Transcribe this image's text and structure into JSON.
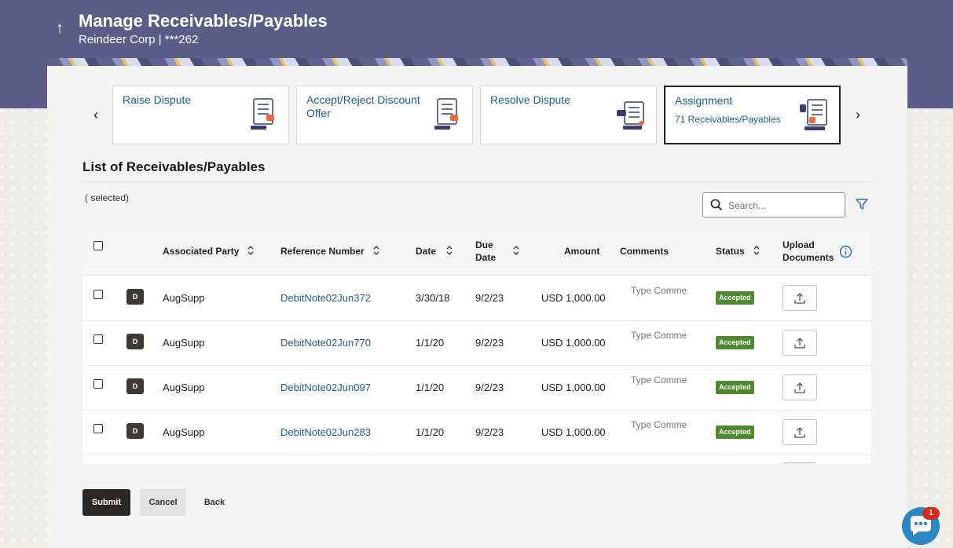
{
  "header": {
    "title": "Manage Receivables/Payables",
    "subtitle": "Reindeer Corp | ***262",
    "back_icon": "↑"
  },
  "carousel": {
    "prev_icon": "‹",
    "next_icon": "›",
    "cards": [
      {
        "title": "Raise Dispute",
        "sub": ""
      },
      {
        "title": "Accept/Reject Discount Offer",
        "sub": ""
      },
      {
        "title": "Resolve Dispute",
        "sub": ""
      },
      {
        "title": "Assignment",
        "sub": "71 Receivables/Payables"
      }
    ]
  },
  "list": {
    "title": "List of Receivables/Payables",
    "selected_text": "( selected)",
    "search_placeholder": "Search..."
  },
  "table": {
    "headers": {
      "party": "Associated Party",
      "reference": "Reference Number",
      "date": "Date",
      "due_date_1": "Due",
      "due_date_2": "Date",
      "amount": "Amount",
      "comments": "Comments",
      "status": "Status",
      "upload_1": "Upload",
      "upload_2": "Documents"
    },
    "rows": [
      {
        "avatar": "D",
        "party": "AugSupp",
        "reference": "DebitNote02Jun372",
        "date": "3/30/18",
        "due": "9/2/23",
        "amount": "USD 1,000.00",
        "comment_placeholder": "Type Comme",
        "status": "Accepted"
      },
      {
        "avatar": "D",
        "party": "AugSupp",
        "reference": "DebitNote02Jun770",
        "date": "1/1/20",
        "due": "9/2/23",
        "amount": "USD 1,000.00",
        "comment_placeholder": "Type Comme",
        "status": "Accepted"
      },
      {
        "avatar": "D",
        "party": "AugSupp",
        "reference": "DebitNote02Jun097",
        "date": "1/1/20",
        "due": "9/2/23",
        "amount": "USD 1,000.00",
        "comment_placeholder": "Type Comme",
        "status": "Accepted"
      },
      {
        "avatar": "D",
        "party": "AugSupp",
        "reference": "DebitNote02Jun283",
        "date": "1/1/20",
        "due": "9/2/23",
        "amount": "USD 1,000.00",
        "comment_placeholder": "Type Comme",
        "status": "Accepted"
      }
    ]
  },
  "actions": {
    "submit": "Submit",
    "cancel": "Cancel",
    "back": "Back"
  },
  "chat": {
    "badge_count": "1"
  },
  "colors": {
    "header_bg": "#595d87",
    "link": "#1f5d8c",
    "accepted_badge": "#4d8a2d",
    "submit_bg": "#2b2724",
    "chat_bg": "#2b87c6"
  }
}
